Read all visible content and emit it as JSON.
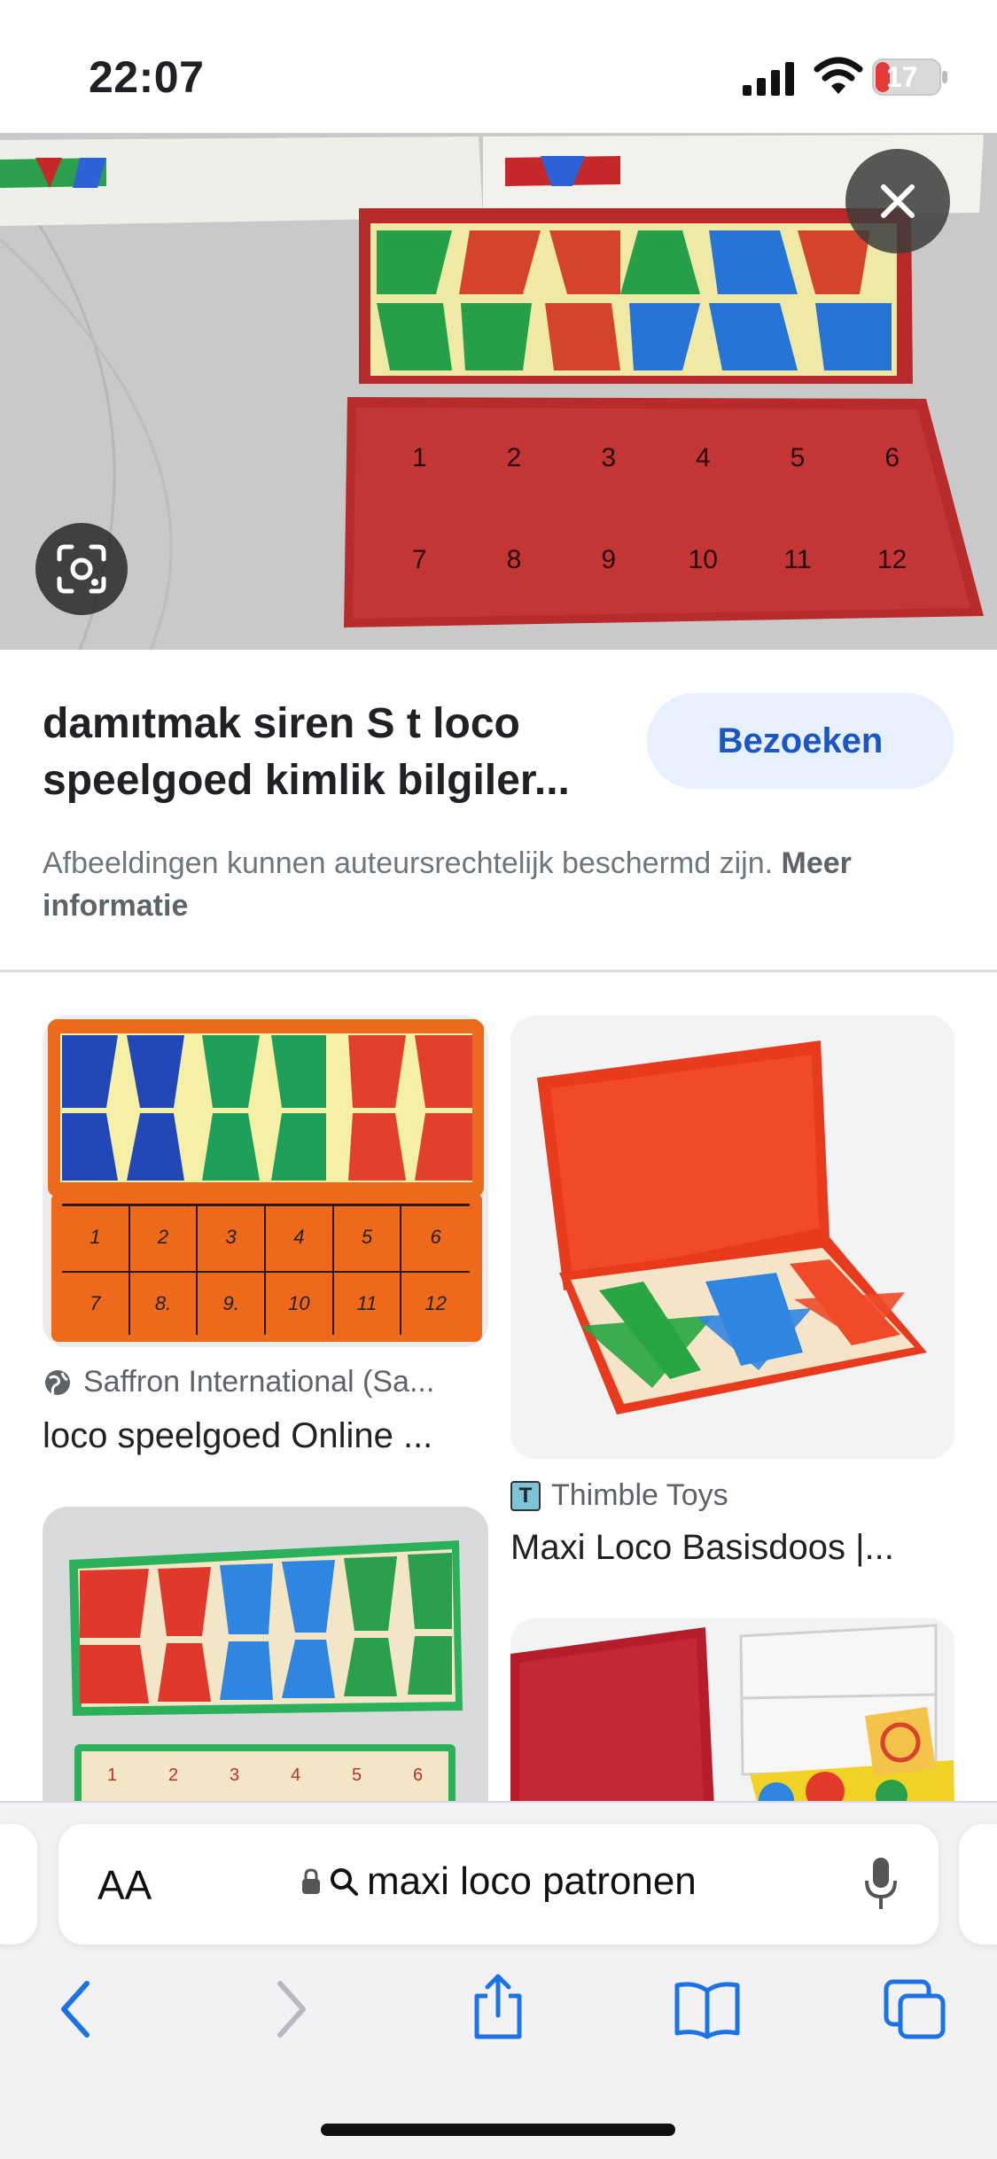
{
  "status_bar": {
    "time": "22:07",
    "battery_level": "17",
    "battery_color": "#e53935"
  },
  "hero": {
    "board_numbers": [
      "1",
      "2",
      "3",
      "4",
      "5",
      "6",
      "7",
      "8",
      "9",
      "10",
      "11",
      "12"
    ]
  },
  "result": {
    "title": "damıtmak siren S t loco speelgoed kimlik bilgiler...",
    "visit_label": "Bezoeken",
    "copyright_text": "Afbeeldingen kunnen auteursrechtelijk beschermd zijn.",
    "more_info_label": "Meer informatie"
  },
  "grid": {
    "items": [
      {
        "source": "Saffron International (Sa...",
        "title": "loco speelgoed Online ...",
        "source_icon": "globe-icon"
      },
      {
        "source": "Thimble Toys",
        "title": "Maxi Loco Basisdoos |...",
        "source_icon": "site-favicon-icon"
      }
    ],
    "card1_numbers": [
      "1",
      "2",
      "3",
      "4",
      "5",
      "6",
      "7",
      "8.",
      "9.",
      "10",
      "11",
      "12"
    ],
    "card3_numbers": [
      "1",
      "2",
      "3",
      "4",
      "5",
      "6"
    ]
  },
  "browser": {
    "aa_label": "AA",
    "url_text": "maxi loco patronen",
    "accent": "#1a73e8"
  }
}
